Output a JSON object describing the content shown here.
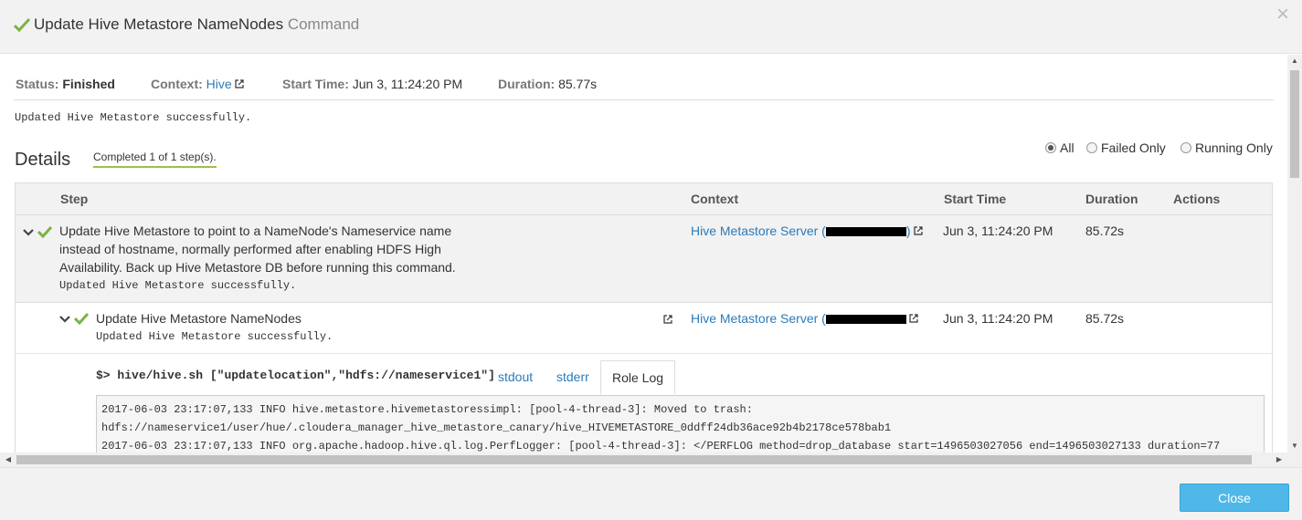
{
  "header": {
    "title": "Update Hive Metastore NameNodes",
    "subtitle": "Command",
    "close_symbol": "×"
  },
  "summary": {
    "status_label": "Status:",
    "status_value": "Finished",
    "context_label": "Context:",
    "context_value": "Hive",
    "start_label": "Start Time:",
    "start_value": "Jun 3, 11:24:20 PM",
    "duration_label": "Duration:",
    "duration_value": "85.77s",
    "message": "Updated Hive Metastore successfully."
  },
  "details": {
    "heading": "Details",
    "completed": "Completed 1 of 1 step(s).",
    "filters": [
      "All",
      "Failed Only",
      "Running Only"
    ],
    "selected_filter": "All"
  },
  "table": {
    "columns": [
      "Step",
      "Context",
      "Start Time",
      "Duration",
      "Actions"
    ],
    "rows": [
      {
        "step_line1": "Update Hive Metastore to point to a NameNode's Nameservice name",
        "step_line2": "instead of hostname, normally performed after enabling HDFS High",
        "step_line3": "Availability. Back up Hive Metastore DB before running this command.",
        "message": "Updated Hive Metastore successfully.",
        "context_prefix": "Hive Metastore Server (",
        "context_suffix": ")",
        "start_time": "Jun 3, 11:24:20 PM",
        "duration": "85.72s"
      },
      {
        "step": "Update Hive Metastore NameNodes",
        "message": "Updated Hive Metastore successfully.",
        "context_prefix": "Hive Metastore Server (",
        "context_suffix": "",
        "start_time": "Jun 3, 11:24:20 PM",
        "duration": "85.72s"
      }
    ]
  },
  "log": {
    "prompt": "$>",
    "command": "hive/hive.sh [\"updatelocation\",\"hdfs://nameservice1\"]",
    "tabs": [
      "stdout",
      "stderr",
      "Role Log"
    ],
    "active_tab": "Role Log",
    "lines": [
      "2017-06-03 23:17:07,133 INFO  hive.metastore.hivemetastoressimpl: [pool-4-thread-3]: Moved to trash:",
      "hdfs://nameservice1/user/hue/.cloudera_manager_hive_metastore_canary/hive_HIVEMETASTORE_0ddff24db36ace92b4b2178ce578bab1",
      "2017-06-03 23:17:07,133 INFO  org.apache.hadoop.hive.ql.log.PerfLogger: [pool-4-thread-3]: </PERFLOG method=drop_database start=1496503027056 end=1496503027133 duration=77"
    ]
  },
  "footer": {
    "close_label": "Close"
  },
  "colors": {
    "link": "#2b7bb9",
    "success": "#7cb342",
    "button": "#4fb8e8"
  },
  "icons": [
    "check-icon",
    "chevron-down-icon",
    "external-link-icon",
    "close-icon"
  ]
}
